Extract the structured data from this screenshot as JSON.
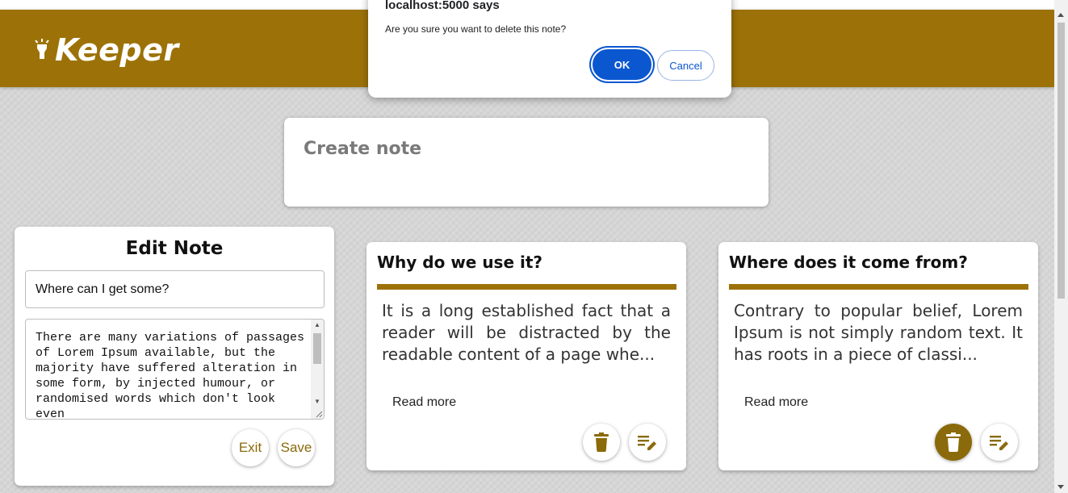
{
  "header": {
    "app_name": "Keeper",
    "icon": "bulb-icon"
  },
  "create_note": {
    "placeholder": "Create note"
  },
  "edit_note": {
    "heading": "Edit Note",
    "title_value": "Where can I get some?",
    "body_value": "There are many variations of passages of Lorem Ipsum available, but the majority have suffered alteration in some form, by injected humour, or randomised words which don't look even",
    "exit_label": "Exit",
    "save_label": "Save"
  },
  "notes": [
    {
      "title": "Why do we use it?",
      "excerpt": "It is a long established fact that a reader will be distracted by the readable content of a page whe...",
      "read_more": "Read more"
    },
    {
      "title": "Where does it come from?",
      "excerpt": "Contrary to popular belief, Lorem Ipsum is not simply random text. It has roots in a piece of classi...",
      "read_more": "Read more"
    }
  ],
  "dialog": {
    "origin": "localhost:5000 says",
    "message": "Are you sure you want to delete this note?",
    "ok_label": "OK",
    "cancel_label": "Cancel"
  },
  "colors": {
    "brand": "#9c7208",
    "dialog_accent": "#0b57d0"
  }
}
